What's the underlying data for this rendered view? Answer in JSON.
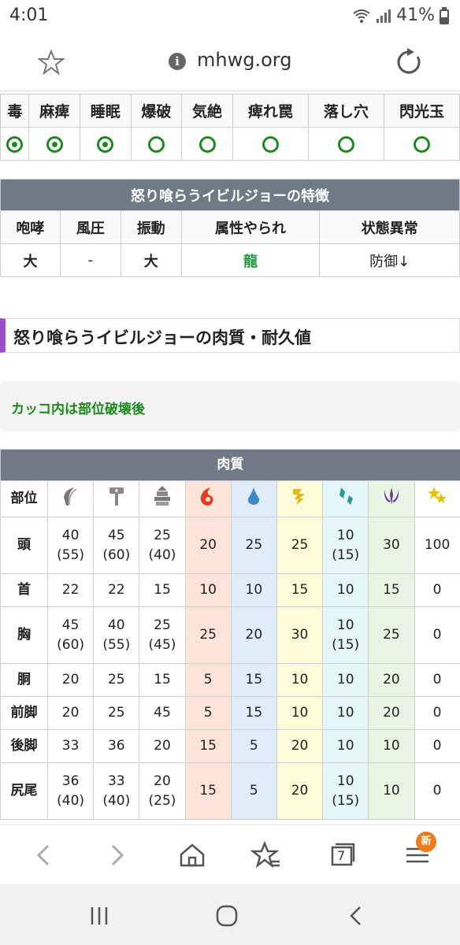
{
  "status_bar": {
    "time": "4:01",
    "battery": "41%"
  },
  "address_bar": {
    "url": "mhwg.org"
  },
  "ailments": {
    "headers": [
      "毒",
      "麻痺",
      "睡眠",
      "爆破",
      "気絶",
      "痺れ罠",
      "落し穴",
      "閃光玉"
    ],
    "marks": [
      "dot",
      "dot",
      "dot",
      "ring",
      "ring",
      "ring",
      "ring",
      "ring"
    ]
  },
  "features": {
    "title": "怒り喰らうイビルジョーの特徴",
    "headers": [
      "咆哮",
      "風圧",
      "振動",
      "属性やられ",
      "状態異常"
    ],
    "values": [
      "大",
      "-",
      "大",
      "龍",
      "防御↓"
    ]
  },
  "section_heading": "怒り喰らうイビルジョーの肉質・耐久値",
  "note": "カッコ内は部位破壊後",
  "hitzones": {
    "title": "肉質",
    "part_header": "部位",
    "column_icons": [
      "cut-icon",
      "blunt-icon",
      "shot-icon",
      "fire-icon",
      "water-icon",
      "thunder-icon",
      "ice-icon",
      "dragon-icon",
      "stun-icon"
    ],
    "rows": [
      {
        "part": "頭",
        "values": [
          [
            "40",
            "(55)"
          ],
          [
            "45",
            "(60)"
          ],
          [
            "25",
            "(40)"
          ],
          [
            "20"
          ],
          [
            "25"
          ],
          [
            "25"
          ],
          [
            "10",
            "(15)"
          ],
          [
            "30"
          ],
          [
            "100"
          ]
        ]
      },
      {
        "part": "首",
        "values": [
          [
            "22"
          ],
          [
            "22"
          ],
          [
            "15"
          ],
          [
            "10"
          ],
          [
            "10"
          ],
          [
            "15"
          ],
          [
            "10"
          ],
          [
            "15"
          ],
          [
            "0"
          ]
        ]
      },
      {
        "part": "胸",
        "values": [
          [
            "45",
            "(60)"
          ],
          [
            "40",
            "(55)"
          ],
          [
            "25",
            "(45)"
          ],
          [
            "25"
          ],
          [
            "20"
          ],
          [
            "30"
          ],
          [
            "10",
            "(15)"
          ],
          [
            "25"
          ],
          [
            "0"
          ]
        ]
      },
      {
        "part": "胴",
        "values": [
          [
            "20"
          ],
          [
            "25"
          ],
          [
            "15"
          ],
          [
            "5"
          ],
          [
            "15"
          ],
          [
            "10"
          ],
          [
            "10"
          ],
          [
            "20"
          ],
          [
            "0"
          ]
        ]
      },
      {
        "part": "前脚",
        "values": [
          [
            "20"
          ],
          [
            "25"
          ],
          [
            "45"
          ],
          [
            "5"
          ],
          [
            "15"
          ],
          [
            "10"
          ],
          [
            "10"
          ],
          [
            "20"
          ],
          [
            "0"
          ]
        ]
      },
      {
        "part": "後脚",
        "values": [
          [
            "33"
          ],
          [
            "36"
          ],
          [
            "20"
          ],
          [
            "15"
          ],
          [
            "5"
          ],
          [
            "20"
          ],
          [
            "10"
          ],
          [
            "10"
          ],
          [
            "0"
          ]
        ]
      },
      {
        "part": "尻尾",
        "values": [
          [
            "36",
            "(40)"
          ],
          [
            "33",
            "(40)"
          ],
          [
            "20",
            "(25)"
          ],
          [
            "15"
          ],
          [
            "5"
          ],
          [
            "20"
          ],
          [
            "10",
            "(15)"
          ],
          [
            "10"
          ],
          [
            "0"
          ]
        ]
      }
    ]
  },
  "bottom_nav": {
    "tabs_count": "7",
    "new_badge": "新"
  }
}
